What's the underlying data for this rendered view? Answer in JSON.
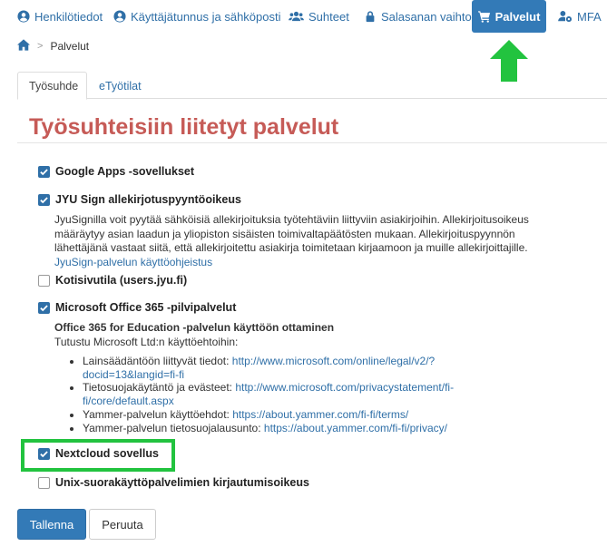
{
  "nav": {
    "items": [
      {
        "label": "Henkilötiedot",
        "icon": "user-circle-icon"
      },
      {
        "label": "Käyttäjätunnus ja sähköposti",
        "icon": "user-circle-icon"
      },
      {
        "label": "Suhteet",
        "icon": "users-icon"
      },
      {
        "label": "Salasanan vaihto",
        "icon": "lock-icon"
      },
      {
        "label": "Palvelut",
        "icon": "cart-icon",
        "active": true
      },
      {
        "label": "MFA",
        "icon": "user-gear-icon"
      }
    ]
  },
  "breadcrumb": {
    "home_icon": "home-icon",
    "current": "Palvelut"
  },
  "tabs": [
    {
      "label": "Työsuhde",
      "active": true
    },
    {
      "label": "eTyötilat",
      "active": false
    }
  ],
  "panel": {
    "title": "Työsuhteisiin liitetyt palvelut",
    "services": [
      {
        "label": "Google Apps -sovellukset",
        "checked": true
      },
      {
        "label": "JYU Sign allekirjotuspyyntöoikeus",
        "checked": true,
        "description": "JyuSignilla voit pyytää sähköisiä allekirjoituksia työtehtäviin liittyviin asiakirjoihin. Allekirjoitusoikeus määräytyy asian laadun ja yliopiston sisäisten toimivaltapäätösten mukaan. Allekirjoituspyynnön lähettäjänä vastaat siitä, että allekirjoitettu asiakirja toimitetaan kirjaamoon ja muille allekirjoittajille.",
        "link_text": "JyuSign-palvelun käyttöohjeistus"
      },
      {
        "label": "Kotisivutila (users.jyu.fi)",
        "checked": false
      },
      {
        "label": "Microsoft Office 365 -pilvipalvelut",
        "checked": true,
        "subheading": "Office 365 for Education -palvelun käyttöön ottaminen",
        "intro": "Tutustu Microsoft Ltd:n käyttöehtoihin:",
        "terms": [
          {
            "label": "Lainsäädäntöön liittyvät tiedot:",
            "link": "http://www.microsoft.com/online/legal/v2/?docid=13&langid=fi-fi"
          },
          {
            "label": "Tietosuojakäytäntö ja evästeet:",
            "link": "http://www.microsoft.com/privacystatement/fi-fi/core/default.aspx"
          },
          {
            "label": "Yammer-palvelun käyttöehdot:",
            "link": "https://about.yammer.com/fi-fi/terms/"
          },
          {
            "label": "Yammer-palvelun tietosuojalausunto:",
            "link": "https://about.yammer.com/fi-fi/privacy/"
          }
        ]
      },
      {
        "label": "Nextcloud sovellus",
        "checked": true
      },
      {
        "label": "Unix-suorakäyttöpalvelimien kirjautumisoikeus",
        "checked": false
      }
    ]
  },
  "buttons": {
    "save": "Tallenna",
    "cancel": "Peruuta"
  },
  "colors": {
    "primary": "#337ab7",
    "title": "#c65b57",
    "annotation_green": "#22c33f"
  }
}
